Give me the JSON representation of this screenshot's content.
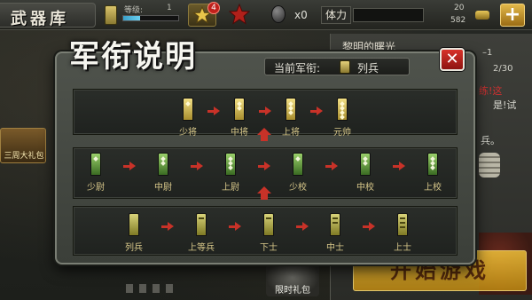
{
  "topbar": {
    "screen_title": "武器库",
    "level_label": "等级:",
    "level_value": "1",
    "level_progress": 0.3,
    "medal_badge": "4",
    "egg_count": "x0",
    "stamina_label": "体力",
    "stamina_progress": 0,
    "res_top": "20",
    "res_bottom": "582",
    "plus_label": "+"
  },
  "side": {
    "title": "黎明的曙光",
    "num1": "–1",
    "num2": "2/30",
    "line1": "练!这",
    "line2": "是!试",
    "line3": "兵。",
    "start_label": "开始游戏"
  },
  "gifts": {
    "left_label": "三周大礼包",
    "bottom_label": "限时礼包"
  },
  "pager": {
    "count": 4
  },
  "modal": {
    "heading": "军衔说明",
    "current_rank_label": "当前军衔:",
    "current_rank_value": "列兵",
    "close_label": "✕",
    "rows": [
      [
        "少将",
        "中将",
        "上将",
        "元帅"
      ],
      [
        "少尉",
        "中尉",
        "上尉",
        "少校",
        "中校",
        "上校"
      ],
      [
        "列兵",
        "上等兵",
        "下士",
        "中士",
        "上士"
      ]
    ]
  },
  "colors": {
    "accent_red": "#c83228",
    "gold_insignia": "#e4d07a",
    "green_insignia": "#6a9a3a",
    "close_red": "#d8322a"
  }
}
